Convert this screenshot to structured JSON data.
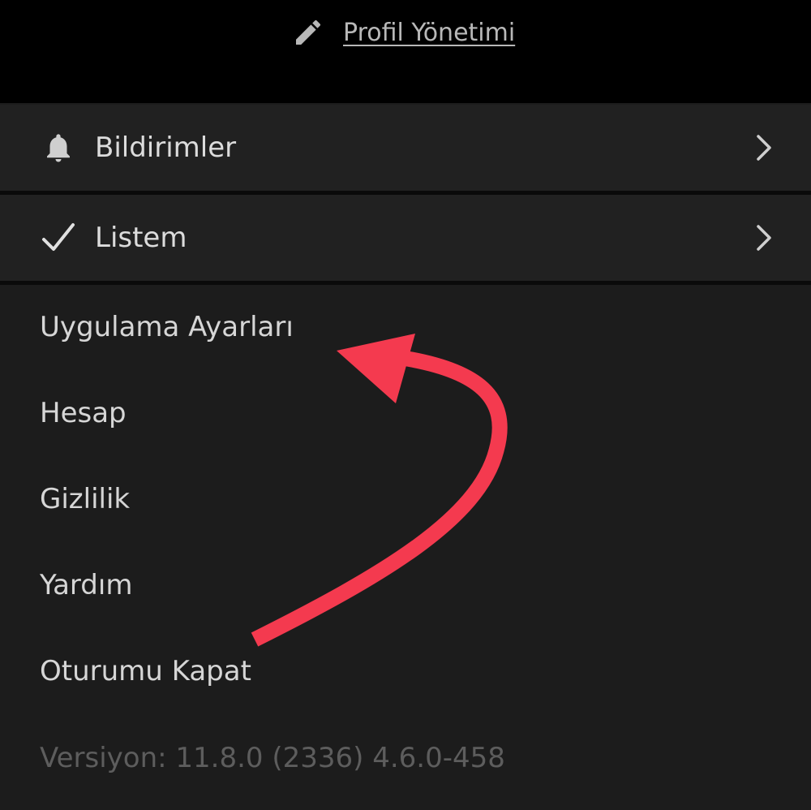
{
  "header": {
    "profile_manage_label": "Profil Yönetimi",
    "profile_manage_icon": "pencil-icon"
  },
  "rows": [
    {
      "label": "Bildirimler",
      "icon": "bell-icon",
      "has_chevron": true
    },
    {
      "label": "Listem",
      "icon": "checkmark-icon",
      "has_chevron": true
    }
  ],
  "menu": {
    "app_settings": "Uygulama Ayarları",
    "account": "Hesap",
    "privacy": "Gizlilik",
    "help": "Yardım",
    "sign_out": "Oturumu Kapat"
  },
  "version_text": "Versiyon: 11.8.0 (2336) 4.6.0-458",
  "annotation": {
    "type": "curved-arrow",
    "color": "#f43a4f",
    "points_to": "Uygulama Ayarları"
  },
  "colors": {
    "top_background": "#000000",
    "page_background": "#1c1c1c",
    "row_background": "#212121",
    "text": "#d6d6d6",
    "muted_text": "#5d5d5d",
    "annotation": "#f43a4f"
  }
}
